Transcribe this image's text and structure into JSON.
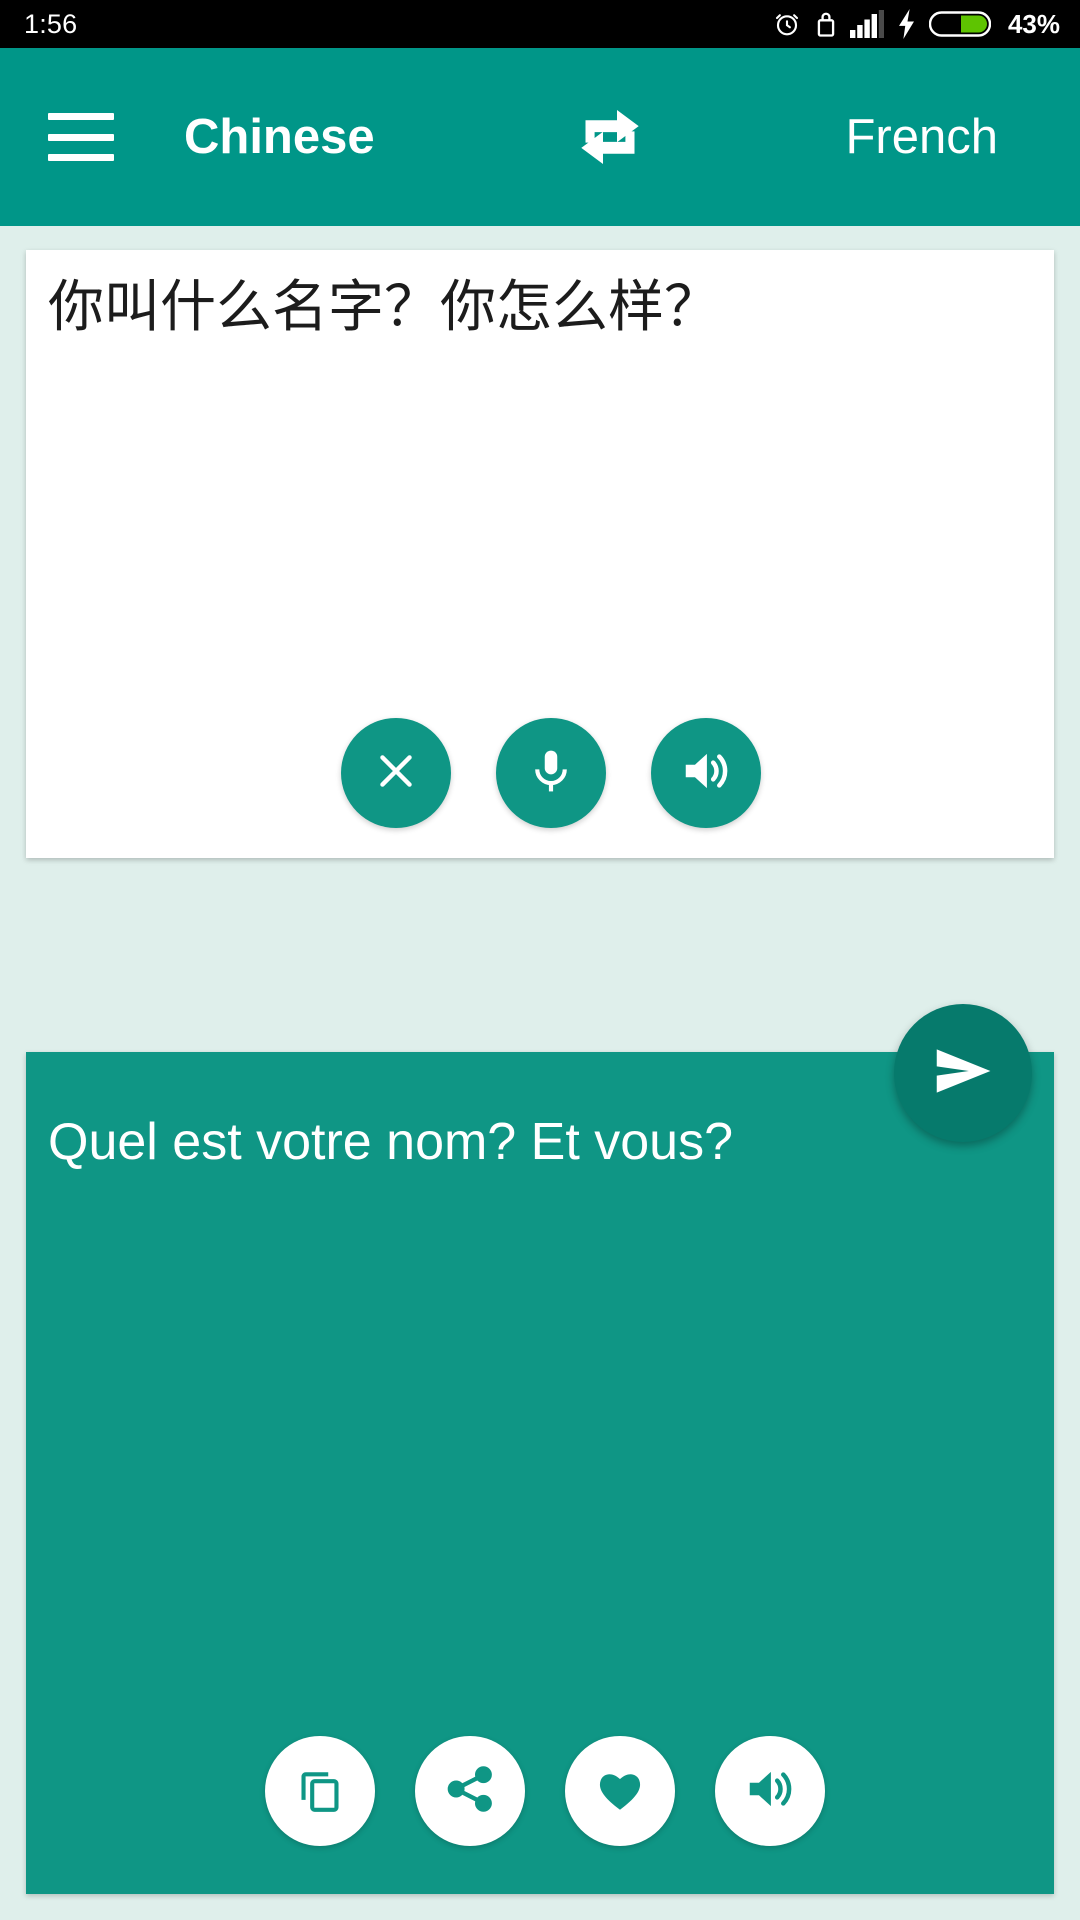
{
  "statusbar": {
    "time": "1:56",
    "battery_percent": "43%",
    "icons": [
      "alarm-icon",
      "lock-icon",
      "signal-icon",
      "charging-bolt-icon",
      "battery-icon"
    ]
  },
  "appbar": {
    "menu_icon": "hamburger-menu-icon",
    "source_language": "Chinese",
    "swap_icon": "swap-languages-icon",
    "target_language": "French",
    "background_color": "#009688"
  },
  "source": {
    "text": "你叫什么名字？你怎么样？",
    "placeholder": "",
    "actions": [
      {
        "name": "clear-button",
        "icon": "close-icon"
      },
      {
        "name": "voice-input-button",
        "icon": "microphone-icon"
      },
      {
        "name": "speak-source-button",
        "icon": "speaker-icon"
      }
    ]
  },
  "send": {
    "icon": "send-icon",
    "color": "#067a6c"
  },
  "target": {
    "text": "Quel est votre nom? Et vous?",
    "background_color": "#0f9685",
    "actions": [
      {
        "name": "copy-button",
        "icon": "copy-icon"
      },
      {
        "name": "share-button",
        "icon": "share-icon"
      },
      {
        "name": "favorite-button",
        "icon": "heart-icon"
      },
      {
        "name": "speak-translation-button",
        "icon": "speaker-icon"
      }
    ]
  }
}
